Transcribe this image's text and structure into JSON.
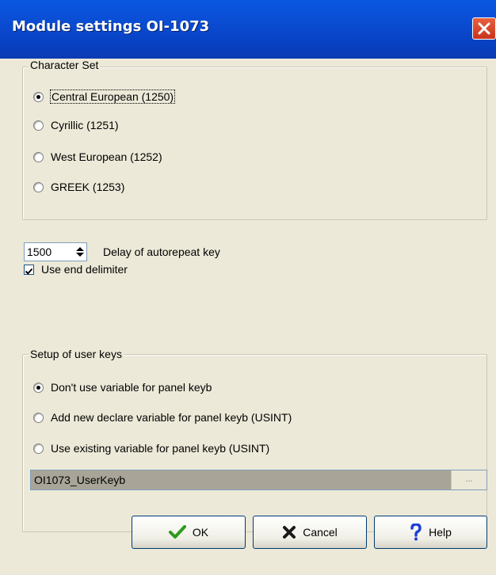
{
  "window": {
    "title": "Module settings OI-1073"
  },
  "character_set": {
    "legend": "Character Set",
    "options": [
      {
        "label": "Central European (1250)",
        "selected": true
      },
      {
        "label": "Cyrillic (1251)",
        "selected": false
      },
      {
        "label": "West European (1252)",
        "selected": false
      },
      {
        "label": "GREEK (1253)",
        "selected": false
      }
    ]
  },
  "autorepeat": {
    "value": "1500",
    "label": "Delay of autorepeat key"
  },
  "end_delimiter": {
    "label": "Use end delimiter",
    "checked": true
  },
  "user_keys": {
    "legend": "Setup of user keys",
    "options": [
      {
        "label": "Don't use variable for panel keyb",
        "selected": true
      },
      {
        "label": "Add new declare variable for panel keyb (USINT)",
        "selected": false
      },
      {
        "label": "Use existing variable for panel keyb (USINT)",
        "selected": false
      }
    ],
    "variable_value": "OI1073_UserKeyb",
    "browse_label": "..."
  },
  "buttons": {
    "ok": "OK",
    "cancel": "Cancel",
    "help": "Help"
  },
  "colors": {
    "title_bar": "#0a4fd6",
    "background": "#ece9d8",
    "ok_icon": "#2d9a1d",
    "cancel_icon": "#1a1a1a",
    "help_icon": "#1d3fd6"
  }
}
